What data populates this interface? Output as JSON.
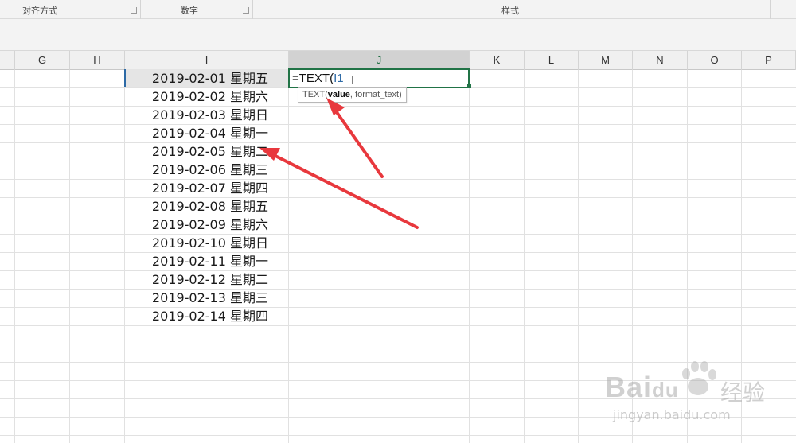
{
  "ribbon": {
    "groups": [
      {
        "label": "对齐方式"
      },
      {
        "label": "数字"
      },
      {
        "label": "样式"
      }
    ]
  },
  "columns": [
    "G",
    "H",
    "I",
    "J",
    "K",
    "L",
    "M",
    "N",
    "O",
    "P"
  ],
  "selected_column": "J",
  "column_i_values": [
    "2019-02-01 星期五",
    "2019-02-02 星期六",
    "2019-02-03 星期日",
    "2019-02-04 星期一",
    "2019-02-05 星期二",
    "2019-02-06 星期三",
    "2019-02-07 星期四",
    "2019-02-08 星期五",
    "2019-02-09 星期六",
    "2019-02-10 星期日",
    "2019-02-11 星期一",
    "2019-02-12 星期二",
    "2019-02-13 星期三",
    "2019-02-14 星期四"
  ],
  "editing_cell": {
    "formula_prefix": "=TEXT(",
    "formula_ref": "I1"
  },
  "tooltip": {
    "fn": "TEXT(",
    "arg_active": "value",
    "rest": ", format_text)"
  },
  "watermark": {
    "brand": "Bai",
    "brand_tail": "du",
    "brand_cn": "经验",
    "url": "jingyan.baidu.com"
  },
  "colors": {
    "accent_green": "#217346",
    "arrow_red": "#e8383d",
    "selection_blue": "#2d6aa6"
  }
}
